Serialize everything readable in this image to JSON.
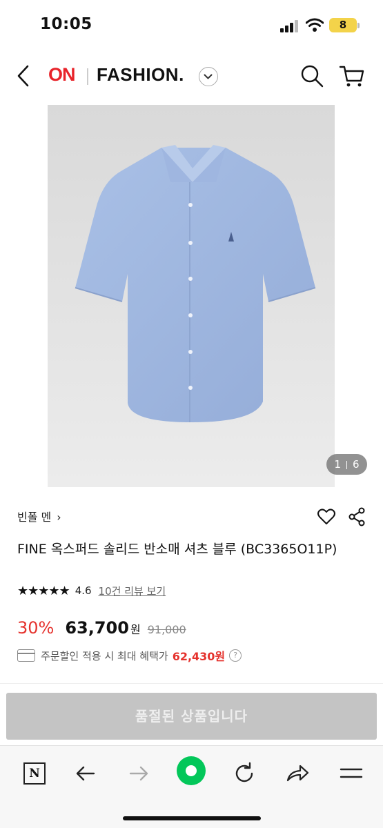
{
  "status_bar": {
    "time": "10:05",
    "battery": "8"
  },
  "header": {
    "logo_on": "ON",
    "logo_fashion": "FASHION.",
    "icons": [
      "back-icon",
      "chevron-down-icon",
      "search-icon",
      "cart-icon"
    ]
  },
  "gallery": {
    "current": "1",
    "total": "6"
  },
  "product": {
    "brand": "빈폴 멘",
    "brand_chevron": "›",
    "title": "FINE 옥스퍼드 솔리드 반소매 셔츠 블루 (BC3365O11P)",
    "rating_stars": "★★★★★",
    "rating": "4.6",
    "review_link": "10건 리뷰 보기",
    "discount": "30%",
    "price": "63,700",
    "currency": "원",
    "original_price": "91,000",
    "coupon_text": "주문할인 적용 시 최대 혜택가",
    "coupon_price": "62,430원",
    "help": "?"
  },
  "cta": {
    "label": "품절된 상품입니다"
  },
  "toolbar": {
    "icons": [
      "naver-n-icon",
      "back-arrow-icon",
      "forward-arrow-icon",
      "green-dot-icon",
      "refresh-icon",
      "share-arrow-icon",
      "menu-icon"
    ],
    "n_label": "N"
  },
  "colors": {
    "accent": "#e8232a",
    "discount": "#e5322d",
    "green": "#03c75a",
    "soldout_bg": "#c4c4c4"
  }
}
